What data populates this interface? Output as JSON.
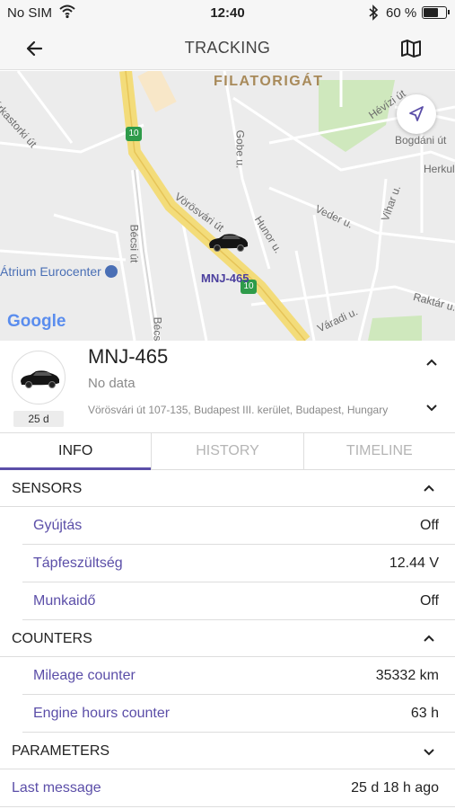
{
  "status_bar": {
    "carrier": "No SIM",
    "time": "12:40",
    "battery": "60 %"
  },
  "header": {
    "title": "TRACKING"
  },
  "map": {
    "district_label": "FILATORIGÁT",
    "poi_label": "Átrium Eurocenter",
    "vehicle_label": "MNJ-465",
    "route_shield": "10",
    "attribution": "Google",
    "streets": {
      "karkastorki": "árkastorki út",
      "hevizi": "Hévízi út",
      "bogdani": "Bogdáni út",
      "herkules": "Herkul",
      "gobe": "Gobe u.",
      "vorosvari": "Vörösvári út",
      "hunor": "Hunor u.",
      "veder": "Veder u.",
      "vihar": "Vihar u.",
      "becsi": "Bécsi út",
      "becsi2": "Bécs",
      "varadi": "Váradi u.",
      "raktar": "Raktár u."
    }
  },
  "vehicle": {
    "plate": "MNJ-465",
    "status": "No data",
    "age": "25 d",
    "address": "Vörösvári út 107-135, Budapest III. kerület, Budapest, Hungary"
  },
  "tabs": [
    {
      "label": "INFO"
    },
    {
      "label": "HISTORY"
    },
    {
      "label": "TIMELINE"
    }
  ],
  "sections": {
    "sensors": {
      "title": "SENSORS",
      "rows": [
        {
          "label": "Gyújtás",
          "value": "Off"
        },
        {
          "label": "Tápfeszültség",
          "value": "12.44 V"
        },
        {
          "label": "Munkaidő",
          "value": "Off"
        }
      ]
    },
    "counters": {
      "title": "COUNTERS",
      "rows": [
        {
          "label": "Mileage counter",
          "value": "35332 km"
        },
        {
          "label": "Engine hours counter",
          "value": "63 h"
        }
      ]
    },
    "parameters": {
      "title": "PARAMETERS"
    },
    "last_message": {
      "label": "Last message",
      "value": "25 d 18 h ago"
    }
  },
  "colors": {
    "accent": "#5b4ea8",
    "route_shield": "#2e9b4a",
    "highway": "#f3dc7a"
  }
}
